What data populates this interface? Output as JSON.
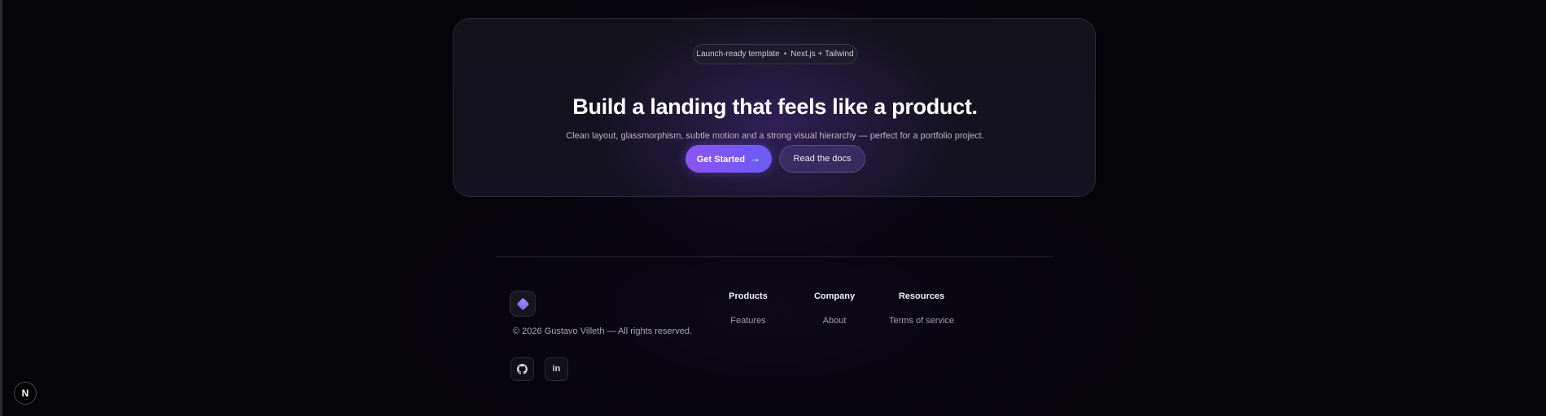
{
  "hero": {
    "badge_left": "Launch-ready template",
    "badge_separator": "•",
    "badge_right": "Next.js + Tailwind",
    "title": "Build a landing that feels like a product.",
    "subtitle": "Clean layout, glassmorphism, subtle motion and a strong visual hierarchy — perfect for a portfolio project.",
    "primary_button": "Get Started",
    "primary_button_arrow": "→",
    "secondary_button": "Read the docs"
  },
  "footer": {
    "copyright": "© 2026 Gustavo Villeth — All rights reserved.",
    "columns": [
      {
        "title": "Products",
        "links": [
          "Features"
        ]
      },
      {
        "title": "Company",
        "links": [
          "About"
        ]
      },
      {
        "title": "Resources",
        "links": [
          "Terms of service"
        ]
      }
    ],
    "social": [
      {
        "icon": "github-icon"
      },
      {
        "icon": "linkedin-icon",
        "text": "in"
      }
    ]
  },
  "devtools_badge": {
    "icon": "nextjs-icon",
    "text": "N"
  },
  "colors": {
    "accent": "#8b5cf6",
    "accent_secondary": "#6366f1",
    "background": "#050408"
  }
}
